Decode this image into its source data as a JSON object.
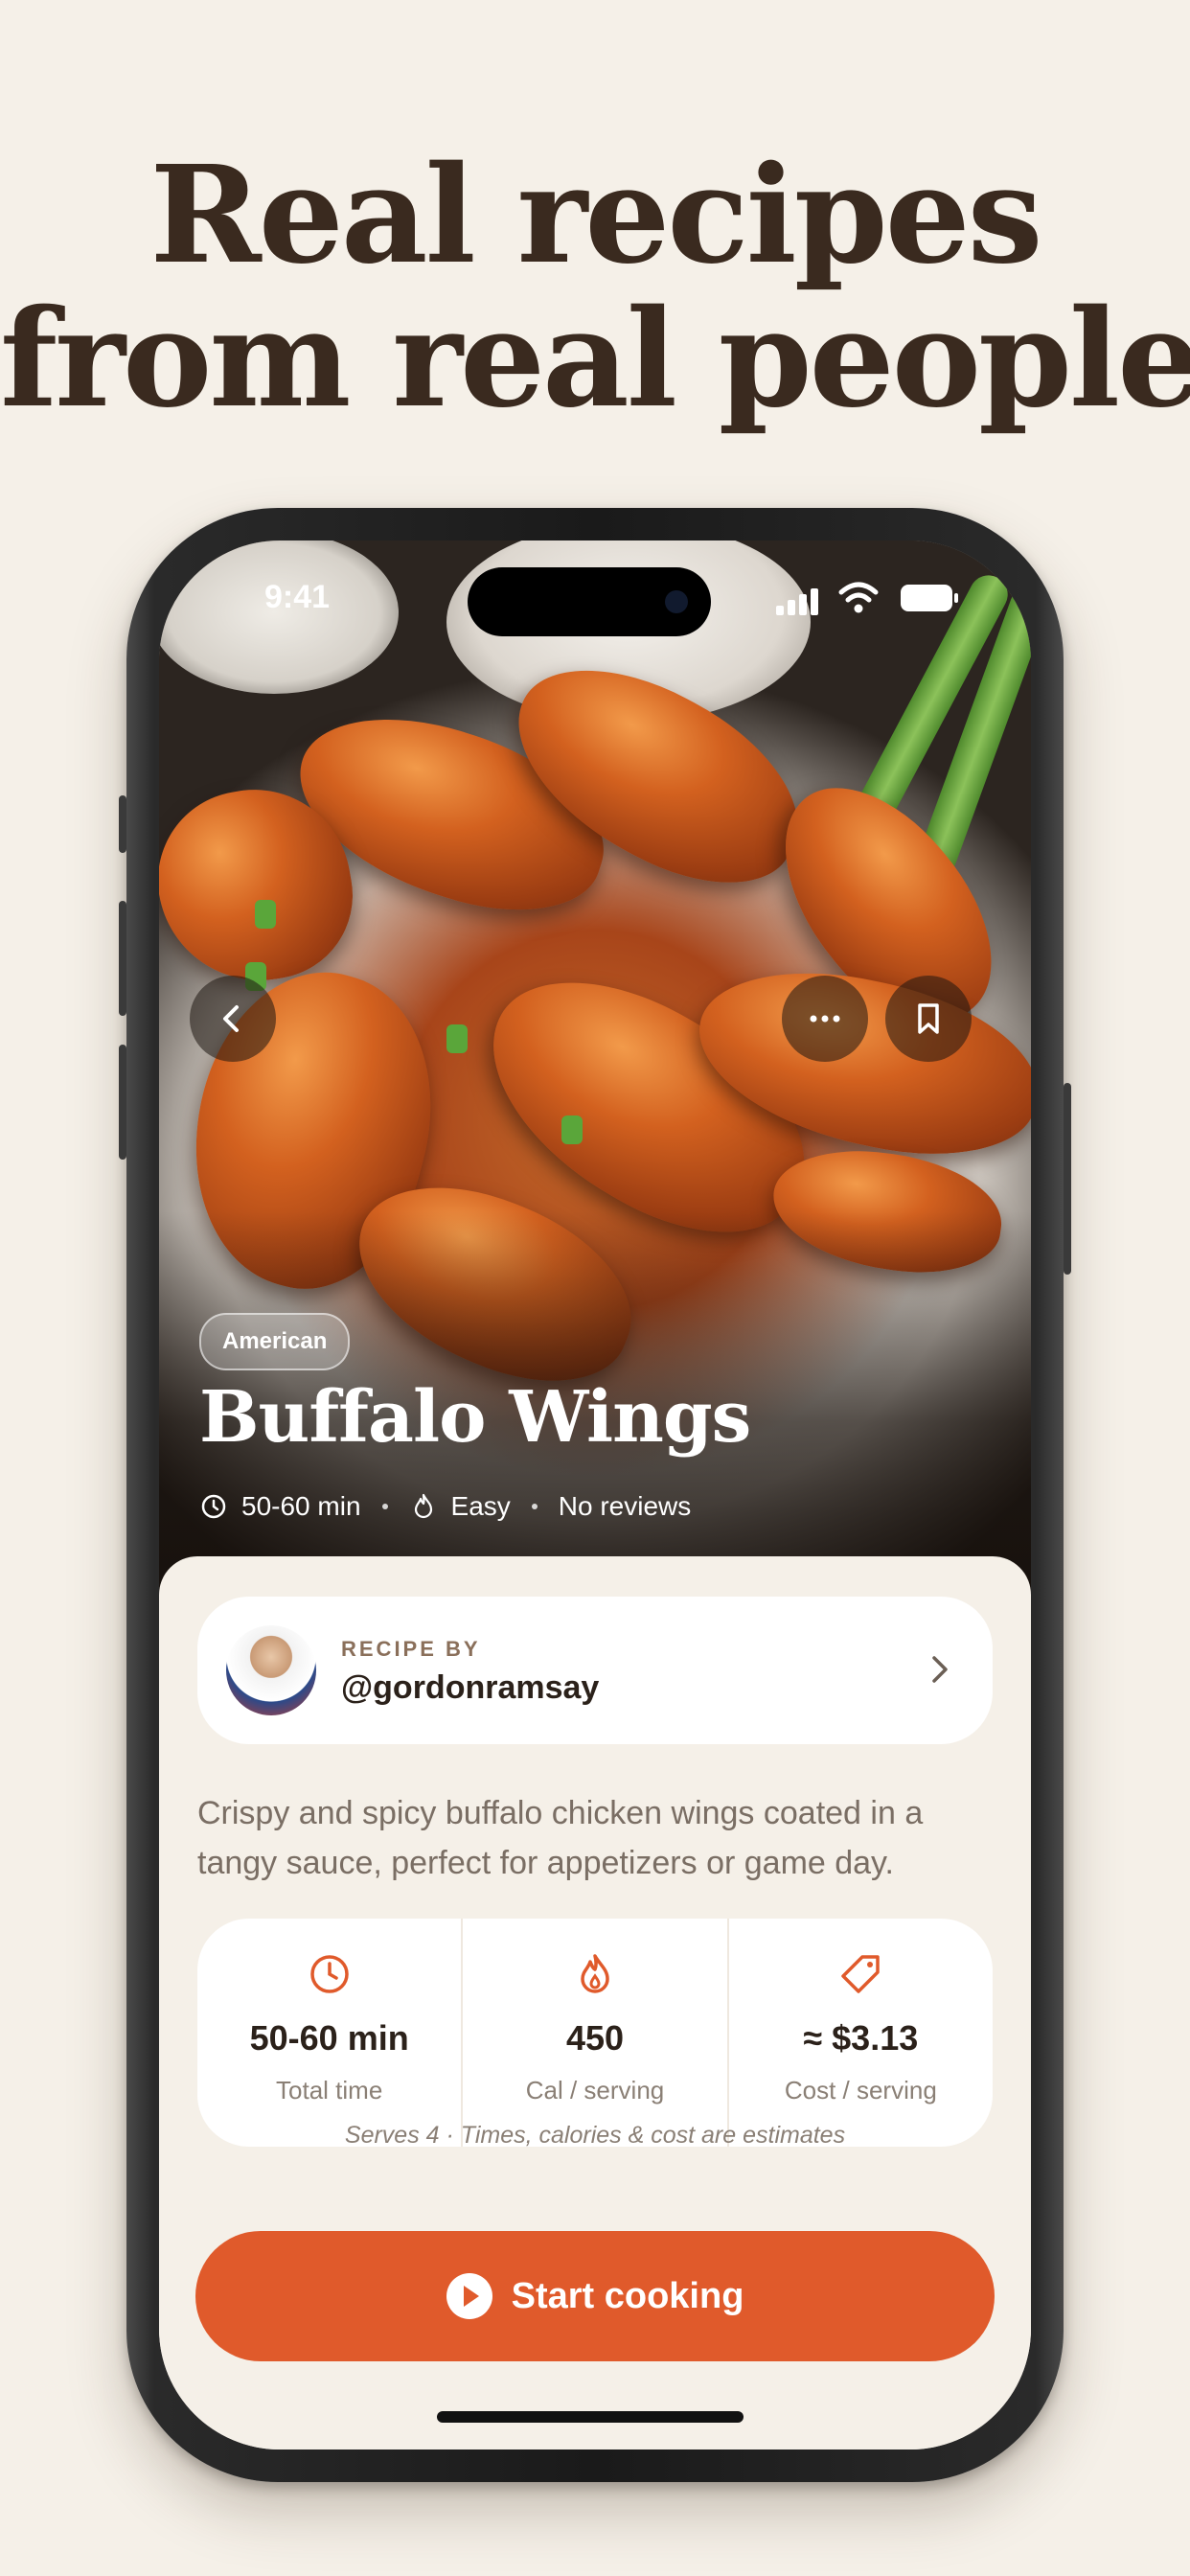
{
  "headline": {
    "line1": "Real recipes",
    "line2": "from real people."
  },
  "status_bar": {
    "time": "9:41"
  },
  "recipe": {
    "cuisine_tag": "American",
    "title": "Buffalo Wings",
    "meta": {
      "time": "50-60 min",
      "difficulty": "Easy",
      "reviews": "No reviews"
    },
    "author": {
      "label": "RECIPE BY",
      "handle": "@gordonramsay"
    },
    "description": "Crispy and spicy buffalo chicken wings coated in a tangy sauce, perfect for appetizers or game day.",
    "stats": [
      {
        "icon": "clock-icon",
        "value": "50-60 min",
        "label": "Total time"
      },
      {
        "icon": "flame-icon",
        "value": "450",
        "label": "Cal / serving"
      },
      {
        "icon": "price-tag-icon",
        "value": "≈ $3.13",
        "label": "Cost / serving"
      }
    ],
    "footnote": "Serves 4 · Times, calories & cost are estimates",
    "cta_label": "Start cooking"
  },
  "colors": {
    "accent": "#e05a2b",
    "background": "#f5f0e8",
    "headline": "#3a2a1f"
  }
}
